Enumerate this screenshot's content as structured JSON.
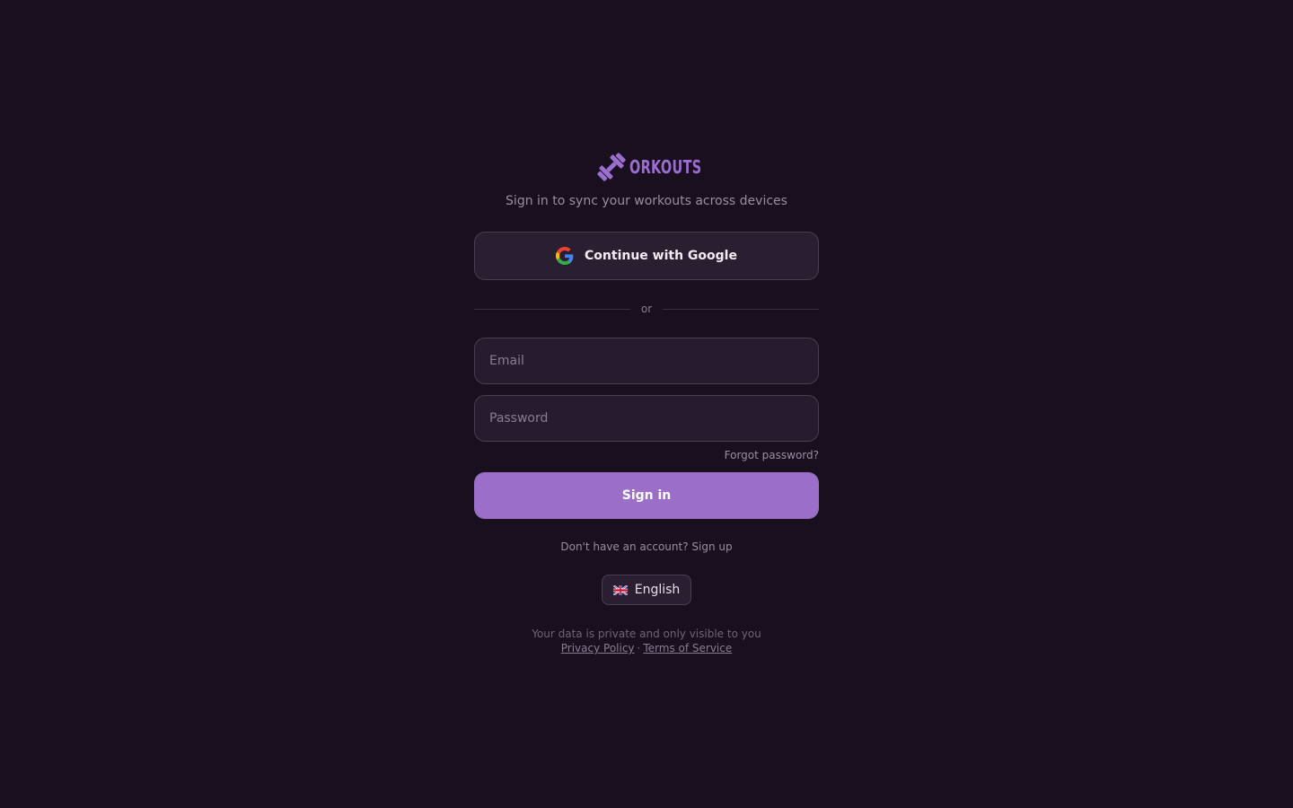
{
  "brand": {
    "logo_text": "ORKOUTS",
    "accent_color": "#9b6fc8"
  },
  "header": {
    "subtitle": "Sign in to sync your workouts across devices"
  },
  "google": {
    "label": "Continue with Google",
    "icon": "google-icon"
  },
  "divider": {
    "label": "or"
  },
  "form": {
    "email_placeholder": "Email",
    "email_value": "",
    "password_placeholder": "Password",
    "password_value": "",
    "forgot_label": "Forgot password?",
    "submit_label": "Sign in"
  },
  "signup": {
    "prompt": "Don't have an account?",
    "link_label": "Sign up"
  },
  "language": {
    "selected": "English",
    "flag_icon": "uk-flag-icon"
  },
  "footer": {
    "privacy_note": "Your data is private and only visible to you",
    "privacy_link": "Privacy Policy",
    "separator": "·",
    "terms_link": "Terms of Service"
  }
}
